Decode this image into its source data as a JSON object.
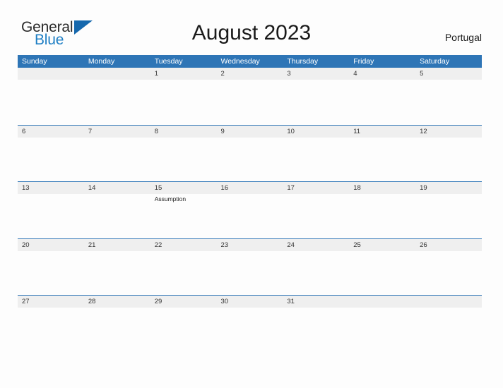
{
  "brand": {
    "word1": "General",
    "word2": "Blue",
    "flag_icon": "triangle-flag-icon",
    "accent_color": "#1f7fc4"
  },
  "header": {
    "title": "August 2023",
    "country": "Portugal"
  },
  "colors": {
    "header_blue": "#2e75b6",
    "band_gray": "#efefef",
    "page_background": "#fdfdfd",
    "text_dark": "#333333"
  },
  "calendar": {
    "weekdays": [
      "Sunday",
      "Monday",
      "Tuesday",
      "Wednesday",
      "Thursday",
      "Friday",
      "Saturday"
    ],
    "weeks": [
      [
        {
          "day": "",
          "events": []
        },
        {
          "day": "",
          "events": []
        },
        {
          "day": "1",
          "events": []
        },
        {
          "day": "2",
          "events": []
        },
        {
          "day": "3",
          "events": []
        },
        {
          "day": "4",
          "events": []
        },
        {
          "day": "5",
          "events": []
        }
      ],
      [
        {
          "day": "6",
          "events": []
        },
        {
          "day": "7",
          "events": []
        },
        {
          "day": "8",
          "events": []
        },
        {
          "day": "9",
          "events": []
        },
        {
          "day": "10",
          "events": []
        },
        {
          "day": "11",
          "events": []
        },
        {
          "day": "12",
          "events": []
        }
      ],
      [
        {
          "day": "13",
          "events": []
        },
        {
          "day": "14",
          "events": []
        },
        {
          "day": "15",
          "events": [
            "Assumption"
          ]
        },
        {
          "day": "16",
          "events": []
        },
        {
          "day": "17",
          "events": []
        },
        {
          "day": "18",
          "events": []
        },
        {
          "day": "19",
          "events": []
        }
      ],
      [
        {
          "day": "20",
          "events": []
        },
        {
          "day": "21",
          "events": []
        },
        {
          "day": "22",
          "events": []
        },
        {
          "day": "23",
          "events": []
        },
        {
          "day": "24",
          "events": []
        },
        {
          "day": "25",
          "events": []
        },
        {
          "day": "26",
          "events": []
        }
      ],
      [
        {
          "day": "27",
          "events": []
        },
        {
          "day": "28",
          "events": []
        },
        {
          "day": "29",
          "events": []
        },
        {
          "day": "30",
          "events": []
        },
        {
          "day": "31",
          "events": []
        },
        {
          "day": "",
          "events": []
        },
        {
          "day": "",
          "events": []
        }
      ]
    ]
  }
}
